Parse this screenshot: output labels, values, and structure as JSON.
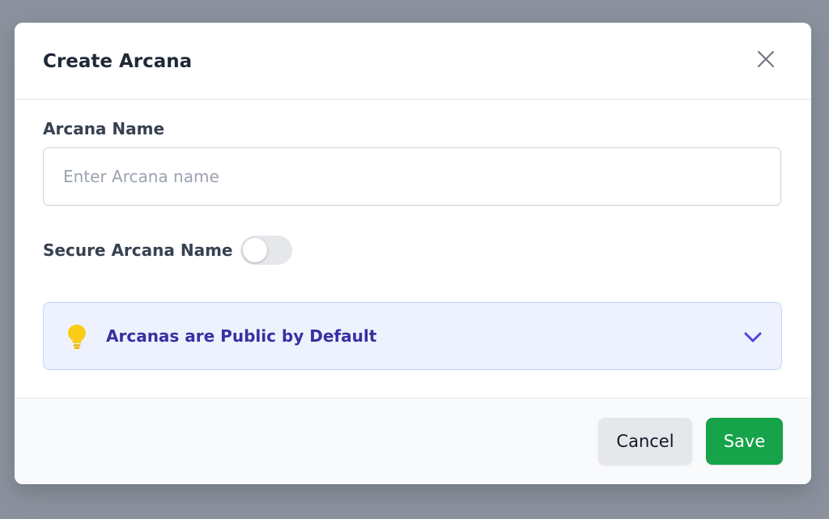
{
  "modal": {
    "title": "Create Arcana"
  },
  "form": {
    "name_label": "Arcana Name",
    "name_value": "",
    "name_placeholder": "Enter Arcana name",
    "secure_label": "Secure Arcana Name",
    "secure_enabled": false
  },
  "info": {
    "text": "Arcanas are Public by Default",
    "icon": "lightbulb-icon",
    "expanded": false
  },
  "footer": {
    "cancel_label": "Cancel",
    "save_label": "Save"
  },
  "colors": {
    "overlay": "#8b929e",
    "save_button": "#16a34a",
    "info_background": "#eef2ff",
    "info_text": "#3730a3",
    "bulb": "#facc15"
  }
}
